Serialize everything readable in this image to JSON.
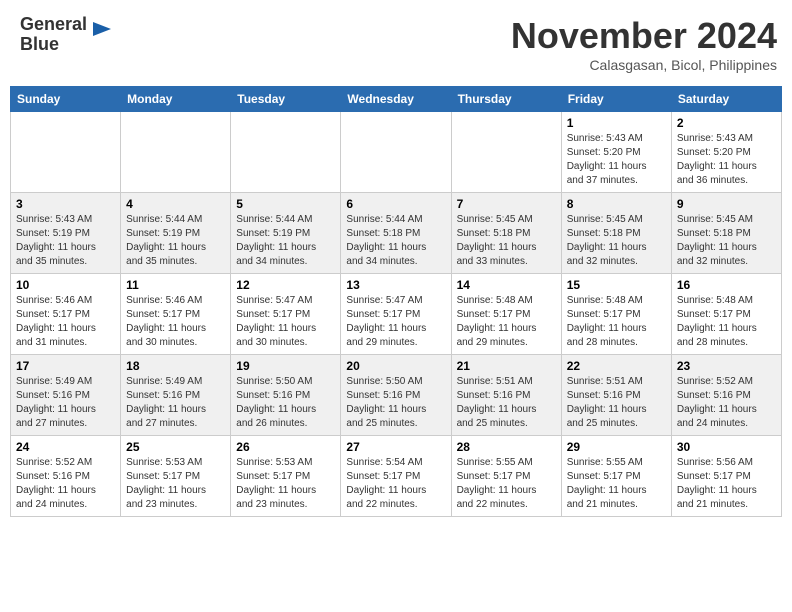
{
  "header": {
    "logo_line1": "General",
    "logo_line2": "Blue",
    "month": "November 2024",
    "location": "Calasgasan, Bicol, Philippines"
  },
  "weekdays": [
    "Sunday",
    "Monday",
    "Tuesday",
    "Wednesday",
    "Thursday",
    "Friday",
    "Saturday"
  ],
  "weeks": [
    [
      {
        "day": "",
        "info": ""
      },
      {
        "day": "",
        "info": ""
      },
      {
        "day": "",
        "info": ""
      },
      {
        "day": "",
        "info": ""
      },
      {
        "day": "",
        "info": ""
      },
      {
        "day": "1",
        "info": "Sunrise: 5:43 AM\nSunset: 5:20 PM\nDaylight: 11 hours\nand 37 minutes."
      },
      {
        "day": "2",
        "info": "Sunrise: 5:43 AM\nSunset: 5:20 PM\nDaylight: 11 hours\nand 36 minutes."
      }
    ],
    [
      {
        "day": "3",
        "info": "Sunrise: 5:43 AM\nSunset: 5:19 PM\nDaylight: 11 hours\nand 35 minutes."
      },
      {
        "day": "4",
        "info": "Sunrise: 5:44 AM\nSunset: 5:19 PM\nDaylight: 11 hours\nand 35 minutes."
      },
      {
        "day": "5",
        "info": "Sunrise: 5:44 AM\nSunset: 5:19 PM\nDaylight: 11 hours\nand 34 minutes."
      },
      {
        "day": "6",
        "info": "Sunrise: 5:44 AM\nSunset: 5:18 PM\nDaylight: 11 hours\nand 34 minutes."
      },
      {
        "day": "7",
        "info": "Sunrise: 5:45 AM\nSunset: 5:18 PM\nDaylight: 11 hours\nand 33 minutes."
      },
      {
        "day": "8",
        "info": "Sunrise: 5:45 AM\nSunset: 5:18 PM\nDaylight: 11 hours\nand 32 minutes."
      },
      {
        "day": "9",
        "info": "Sunrise: 5:45 AM\nSunset: 5:18 PM\nDaylight: 11 hours\nand 32 minutes."
      }
    ],
    [
      {
        "day": "10",
        "info": "Sunrise: 5:46 AM\nSunset: 5:17 PM\nDaylight: 11 hours\nand 31 minutes."
      },
      {
        "day": "11",
        "info": "Sunrise: 5:46 AM\nSunset: 5:17 PM\nDaylight: 11 hours\nand 30 minutes."
      },
      {
        "day": "12",
        "info": "Sunrise: 5:47 AM\nSunset: 5:17 PM\nDaylight: 11 hours\nand 30 minutes."
      },
      {
        "day": "13",
        "info": "Sunrise: 5:47 AM\nSunset: 5:17 PM\nDaylight: 11 hours\nand 29 minutes."
      },
      {
        "day": "14",
        "info": "Sunrise: 5:48 AM\nSunset: 5:17 PM\nDaylight: 11 hours\nand 29 minutes."
      },
      {
        "day": "15",
        "info": "Sunrise: 5:48 AM\nSunset: 5:17 PM\nDaylight: 11 hours\nand 28 minutes."
      },
      {
        "day": "16",
        "info": "Sunrise: 5:48 AM\nSunset: 5:17 PM\nDaylight: 11 hours\nand 28 minutes."
      }
    ],
    [
      {
        "day": "17",
        "info": "Sunrise: 5:49 AM\nSunset: 5:16 PM\nDaylight: 11 hours\nand 27 minutes."
      },
      {
        "day": "18",
        "info": "Sunrise: 5:49 AM\nSunset: 5:16 PM\nDaylight: 11 hours\nand 27 minutes."
      },
      {
        "day": "19",
        "info": "Sunrise: 5:50 AM\nSunset: 5:16 PM\nDaylight: 11 hours\nand 26 minutes."
      },
      {
        "day": "20",
        "info": "Sunrise: 5:50 AM\nSunset: 5:16 PM\nDaylight: 11 hours\nand 25 minutes."
      },
      {
        "day": "21",
        "info": "Sunrise: 5:51 AM\nSunset: 5:16 PM\nDaylight: 11 hours\nand 25 minutes."
      },
      {
        "day": "22",
        "info": "Sunrise: 5:51 AM\nSunset: 5:16 PM\nDaylight: 11 hours\nand 25 minutes."
      },
      {
        "day": "23",
        "info": "Sunrise: 5:52 AM\nSunset: 5:16 PM\nDaylight: 11 hours\nand 24 minutes."
      }
    ],
    [
      {
        "day": "24",
        "info": "Sunrise: 5:52 AM\nSunset: 5:16 PM\nDaylight: 11 hours\nand 24 minutes."
      },
      {
        "day": "25",
        "info": "Sunrise: 5:53 AM\nSunset: 5:17 PM\nDaylight: 11 hours\nand 23 minutes."
      },
      {
        "day": "26",
        "info": "Sunrise: 5:53 AM\nSunset: 5:17 PM\nDaylight: 11 hours\nand 23 minutes."
      },
      {
        "day": "27",
        "info": "Sunrise: 5:54 AM\nSunset: 5:17 PM\nDaylight: 11 hours\nand 22 minutes."
      },
      {
        "day": "28",
        "info": "Sunrise: 5:55 AM\nSunset: 5:17 PM\nDaylight: 11 hours\nand 22 minutes."
      },
      {
        "day": "29",
        "info": "Sunrise: 5:55 AM\nSunset: 5:17 PM\nDaylight: 11 hours\nand 21 minutes."
      },
      {
        "day": "30",
        "info": "Sunrise: 5:56 AM\nSunset: 5:17 PM\nDaylight: 11 hours\nand 21 minutes."
      }
    ]
  ]
}
